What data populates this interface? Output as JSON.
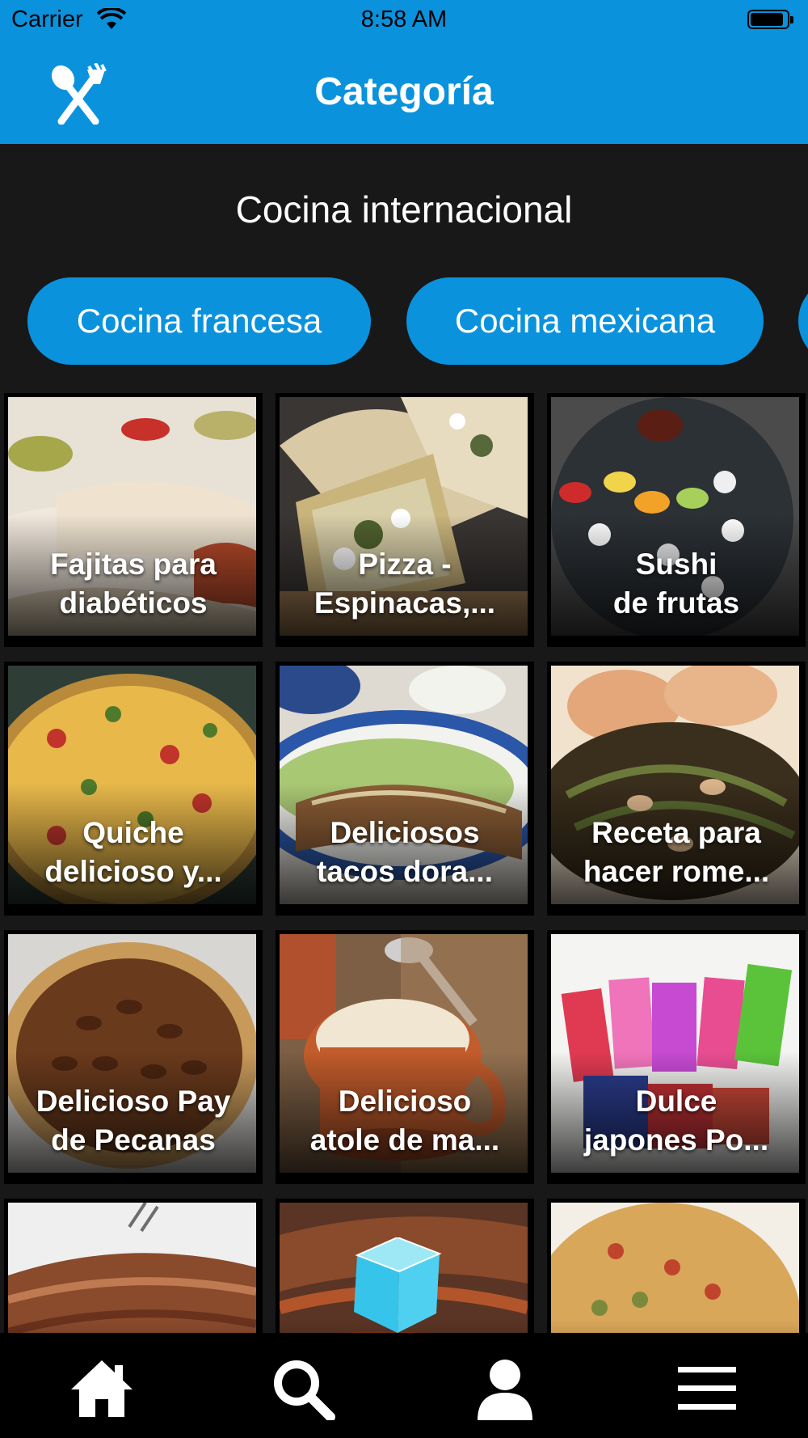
{
  "status_bar": {
    "carrier": "Carrier",
    "time": "8:58 AM",
    "battery_level": 0.9
  },
  "nav": {
    "title": "Categoría",
    "logo_icon": "fork-knife-icon"
  },
  "section": {
    "title": "Cocina internacional"
  },
  "chips": [
    {
      "label": "Cocina francesa"
    },
    {
      "label": "Cocina mexicana"
    },
    {
      "label": ""
    }
  ],
  "recipes": [
    {
      "title": "Fajitas para\ndiabéticos"
    },
    {
      "title": "Pizza -\nEspinacas,..."
    },
    {
      "title": "Sushi\nde frutas"
    },
    {
      "title": "Quiche\ndelicioso y..."
    },
    {
      "title": "Deliciosos\ntacos dora..."
    },
    {
      "title": "Receta para\nhacer rome..."
    },
    {
      "title": "Delicioso Pay\nde Pecanas"
    },
    {
      "title": "Delicioso\natole de ma..."
    },
    {
      "title": "Dulce\njapones Po..."
    },
    {
      "title": ""
    },
    {
      "title": ""
    },
    {
      "title": ""
    }
  ],
  "tab_bar": {
    "items": [
      {
        "icon": "home-icon"
      },
      {
        "icon": "search-icon"
      },
      {
        "icon": "profile-icon"
      },
      {
        "icon": "menu-icon"
      }
    ]
  },
  "colors": {
    "accent": "#0a92dd",
    "background": "#181818",
    "tab_bar": "#000000"
  }
}
